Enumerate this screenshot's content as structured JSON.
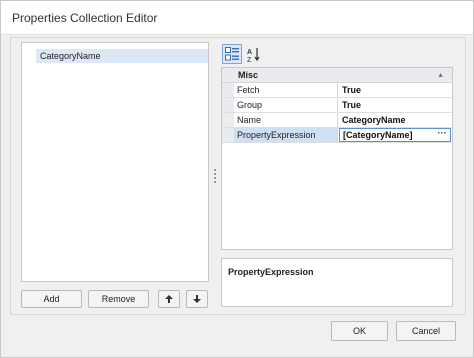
{
  "window": {
    "title": "Properties Collection Editor"
  },
  "list": {
    "items": [
      {
        "label": "CategoryName",
        "selected": true
      }
    ]
  },
  "list_buttons": {
    "add": "Add",
    "remove": "Remove",
    "move_up_icon": "arrow-up-icon",
    "move_down_icon": "arrow-down-icon"
  },
  "toolbar": {
    "categorized_icon": "categorized-view-icon",
    "alphabetical_icon": "sort-alphabetical-icon",
    "active": "categorized"
  },
  "property_grid": {
    "category": "Misc",
    "rows": [
      {
        "name": "Fetch",
        "value": "True"
      },
      {
        "name": "Group",
        "value": "True"
      },
      {
        "name": "Name",
        "value": "CategoryName"
      },
      {
        "name": "PropertyExpression",
        "value": "[CategoryName]",
        "ellipsis": "···"
      }
    ],
    "selected_row": 3
  },
  "description": {
    "title": "PropertyExpression"
  },
  "dialog_buttons": {
    "ok": "OK",
    "cancel": "Cancel"
  },
  "colors": {
    "selection": "#dde8f6",
    "grid_selection": "#cfdff4",
    "focus_border": "#5b8fd6"
  }
}
